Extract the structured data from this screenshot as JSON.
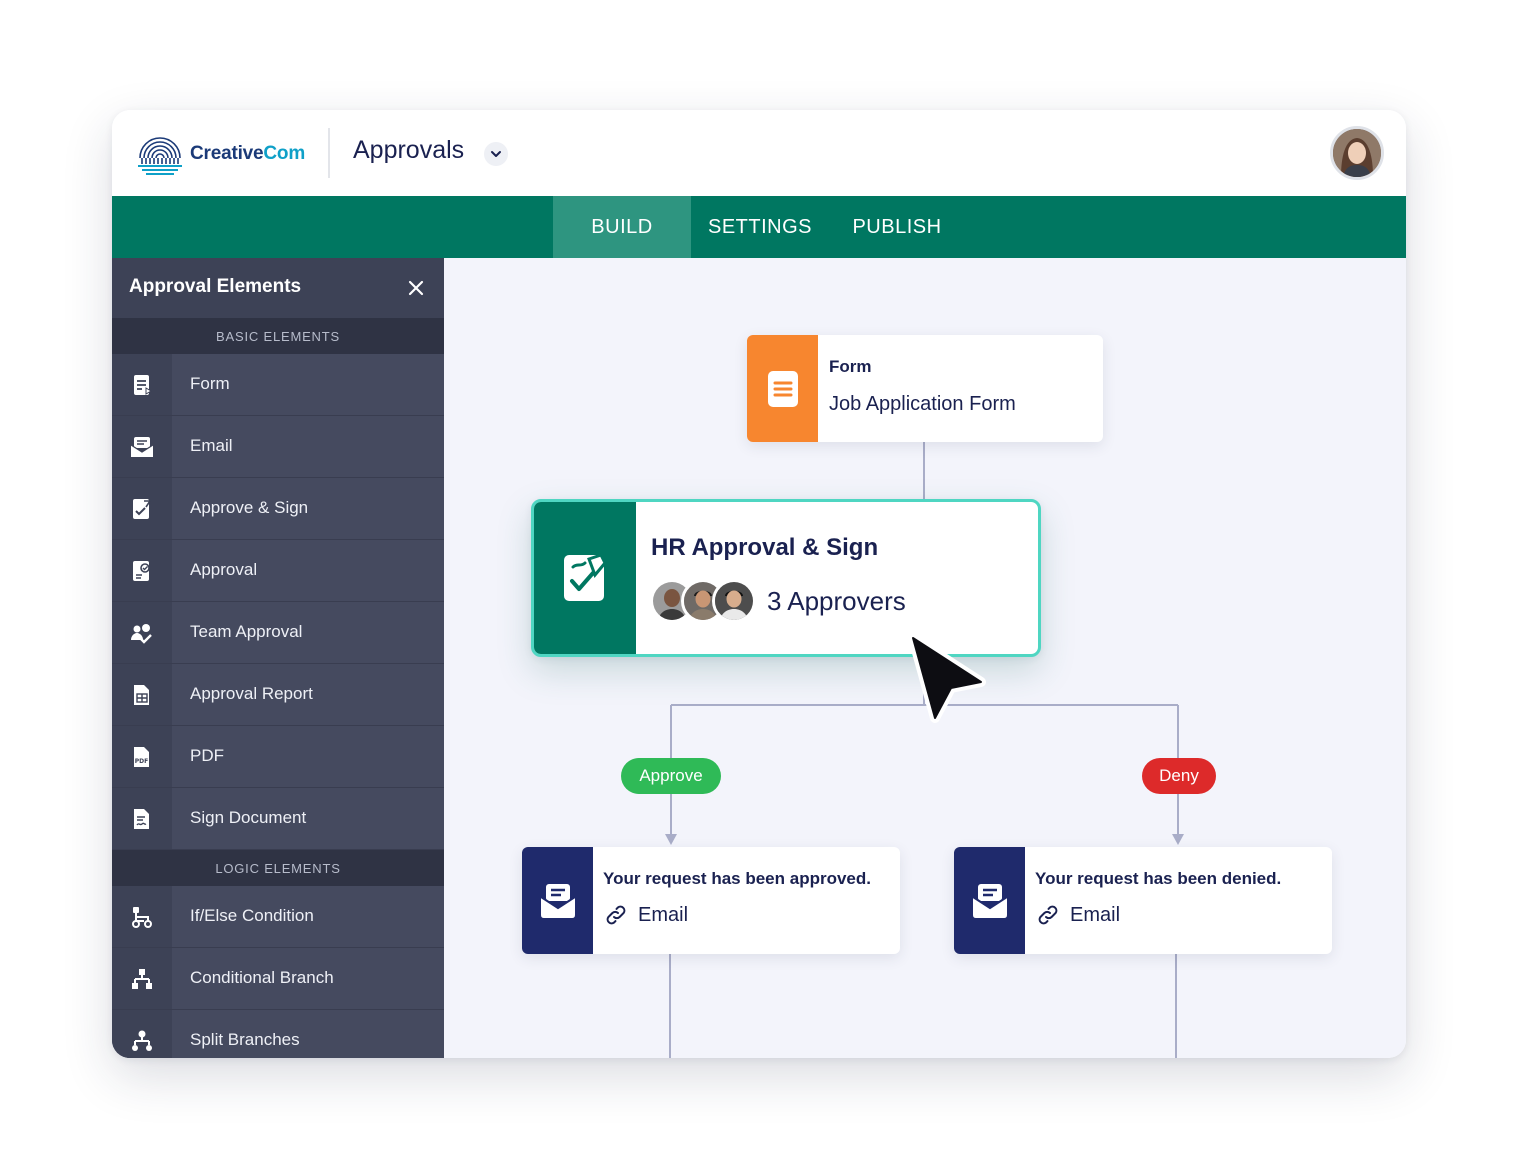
{
  "header": {
    "logo_prefix": "Creative",
    "logo_suffix": "Com",
    "app_title": "Approvals"
  },
  "nav": {
    "tabs": [
      {
        "label": "BUILD",
        "active": true
      },
      {
        "label": "SETTINGS",
        "active": false
      },
      {
        "label": "PUBLISH",
        "active": false
      }
    ]
  },
  "sidebar": {
    "title": "Approval Elements",
    "basic_label": "BASIC ELEMENTS",
    "basic_items": [
      {
        "label": "Form",
        "icon": "form-icon"
      },
      {
        "label": "Email",
        "icon": "email-icon"
      },
      {
        "label": "Approve & Sign",
        "icon": "approve-sign-icon"
      },
      {
        "label": "Approval",
        "icon": "approval-icon"
      },
      {
        "label": "Team Approval",
        "icon": "team-approval-icon"
      },
      {
        "label": "Approval Report",
        "icon": "approval-report-icon"
      },
      {
        "label": "PDF",
        "icon": "pdf-icon"
      },
      {
        "label": "Sign Document",
        "icon": "sign-document-icon"
      }
    ],
    "logic_label": "LOGIC ELEMENTS",
    "logic_items": [
      {
        "label": "If/Else Condition",
        "icon": "if-else-icon"
      },
      {
        "label": "Conditional Branch",
        "icon": "conditional-branch-icon"
      },
      {
        "label": "Split Branches",
        "icon": "split-branches-icon"
      }
    ]
  },
  "flow": {
    "form_node": {
      "type": "Form",
      "name": "Job Application Form"
    },
    "approval_node": {
      "title": "HR Approval & Sign",
      "approvers": "3 Approvers"
    },
    "approve_label": "Approve",
    "deny_label": "Deny",
    "approved_email": {
      "message": "Your request has been approved.",
      "link": "Email"
    },
    "denied_email": {
      "message": "Your request has been denied.",
      "link": "Email"
    }
  },
  "colors": {
    "nav_green": "#007761",
    "nav_active": "#2e9580",
    "form_orange": "#f7862f",
    "email_navy": "#1f2a6c",
    "approve_green": "#2fba57",
    "deny_red": "#dd2a2a",
    "highlight_teal": "#4fd6c2"
  }
}
